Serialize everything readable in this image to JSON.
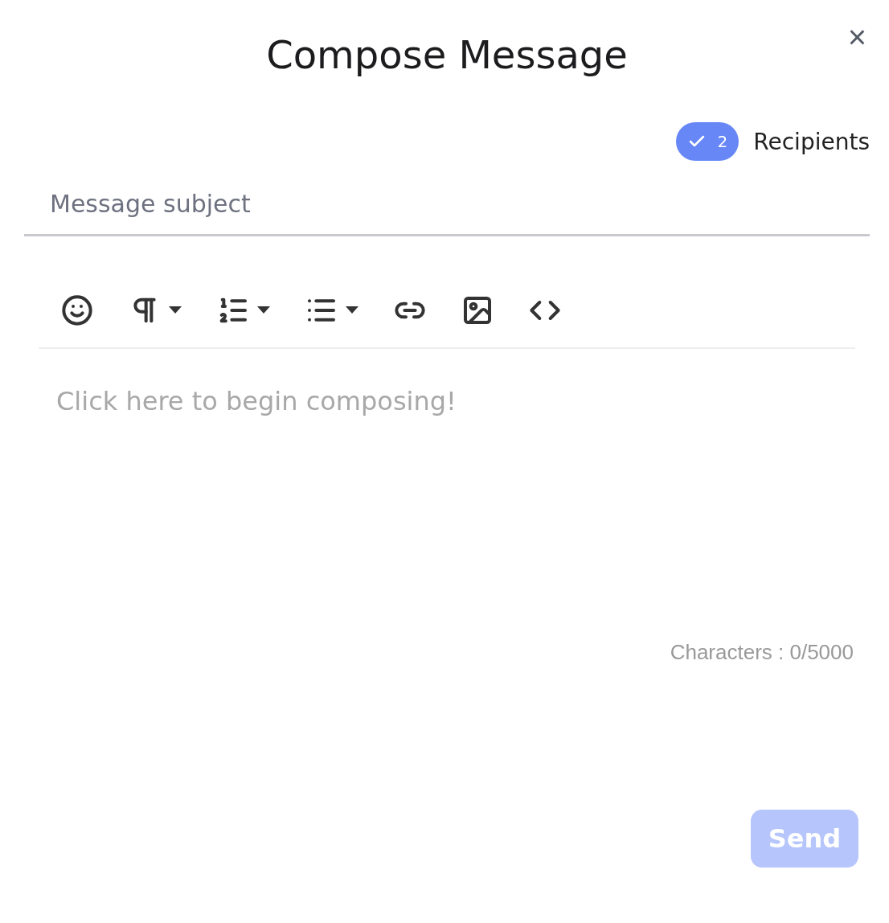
{
  "dialog": {
    "title": "Compose Message",
    "close_label": "×"
  },
  "recipients": {
    "count": "2",
    "label": "Recipients",
    "checked": true
  },
  "subject": {
    "placeholder": "Message subject"
  },
  "toolbar": [
    {
      "kind": "emoji",
      "has_dropdown": false
    },
    {
      "kind": "paragraph",
      "has_dropdown": true
    },
    {
      "kind": "ordered-list",
      "has_dropdown": true
    },
    {
      "kind": "bullet-list",
      "has_dropdown": true
    },
    {
      "kind": "link",
      "has_dropdown": false
    },
    {
      "kind": "image",
      "has_dropdown": false
    },
    {
      "kind": "code",
      "has_dropdown": false
    }
  ],
  "editor": {
    "placeholder": "Click here to begin composing!"
  },
  "counter": "Characters : 0/5000",
  "send": {
    "label": "Send",
    "disabled": true
  }
}
